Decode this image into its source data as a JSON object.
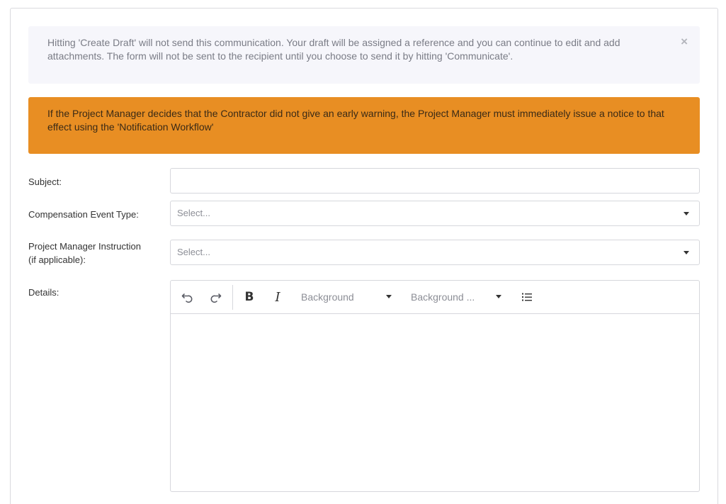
{
  "info_alert": {
    "text": "Hitting 'Create Draft' will not send this communication. Your draft will be assigned a reference and you can continue to edit and add attachments. The form will not be sent to the recipient until you choose to send it by hitting 'Communicate'.",
    "close_glyph": "×"
  },
  "warning_alert": {
    "text": "If the Project Manager decides that the Contractor did not give an early warning, the Project Manager must immediately issue a notice to that effect using the 'Notification Workflow'"
  },
  "form": {
    "subject": {
      "label": "Subject:",
      "value": ""
    },
    "compensation_event_type": {
      "label": "Compensation Event Type:",
      "value": "Select..."
    },
    "pm_instruction": {
      "label_line1": "Project Manager Instruction",
      "label_line2": "(if applicable):",
      "value": "Select..."
    },
    "details": {
      "label": "Details:"
    }
  },
  "editor": {
    "toolbar": {
      "undo_icon": "undo-icon",
      "redo_icon": "redo-icon",
      "bold_label": "B",
      "italic_label": "I",
      "foreground_label": "Background",
      "background_label": "Background ...",
      "list_icon": "bullet-list-icon"
    },
    "content": ""
  },
  "colors": {
    "info_bg": "#f6f6fb",
    "warning_bg": "#e88e23",
    "border": "#d6d7dc"
  }
}
